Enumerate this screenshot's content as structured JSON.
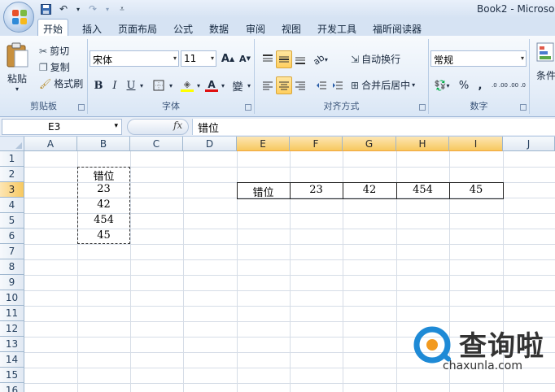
{
  "window": {
    "title": "Book2 - Microso"
  },
  "tabs": [
    "开始",
    "插入",
    "页面布局",
    "公式",
    "数据",
    "审阅",
    "视图",
    "开发工具",
    "福昕阅读器"
  ],
  "ribbon": {
    "clipboard": {
      "label": "剪贴板",
      "paste": "粘贴",
      "cut": "剪切",
      "copy": "复制",
      "format_painter": "格式刷"
    },
    "font": {
      "label": "字体",
      "name": "宋体",
      "size": "11",
      "bold": "B",
      "italic": "I",
      "underline": "U",
      "grow": "A",
      "shrink": "A",
      "font_color_glyph": "A",
      "phonetic": "變"
    },
    "alignment": {
      "label": "对齐方式",
      "wrap": "自动换行",
      "merge": "合并后居中"
    },
    "number": {
      "label": "数字",
      "format": "常规",
      "percent": "%",
      "comma": ",",
      "inc_decimal": ".0 .00",
      "dec_decimal": ".00 .0"
    },
    "styles": {
      "conditional": "条件"
    }
  },
  "formula_bar": {
    "name_box": "E3",
    "fx": "fx",
    "content": "错位"
  },
  "grid": {
    "columns": [
      "A",
      "B",
      "C",
      "D",
      "E",
      "F",
      "G",
      "H",
      "I",
      "J"
    ],
    "rows": [
      "1",
      "2",
      "3",
      "4",
      "5",
      "6",
      "7",
      "8",
      "9",
      "10",
      "11",
      "12",
      "13",
      "14",
      "15",
      "16"
    ],
    "selected_column_range": [
      "E",
      "I"
    ],
    "selected_row": "3",
    "column_b": [
      "错位",
      "23",
      "42",
      "454",
      "45"
    ],
    "row_3": [
      "错位",
      "23",
      "42",
      "454",
      "45"
    ]
  },
  "watermark": {
    "text": "查询啦",
    "url": "chaxunla.com"
  },
  "colors": {
    "ribbon_bg": "#dbe6f4",
    "header_selected": "#f7c85f",
    "font_color_bar": "#e01010",
    "highlight_bar": "#ffff00",
    "logo_blue": "#1e8ad6",
    "logo_orange": "#f29a1f"
  }
}
